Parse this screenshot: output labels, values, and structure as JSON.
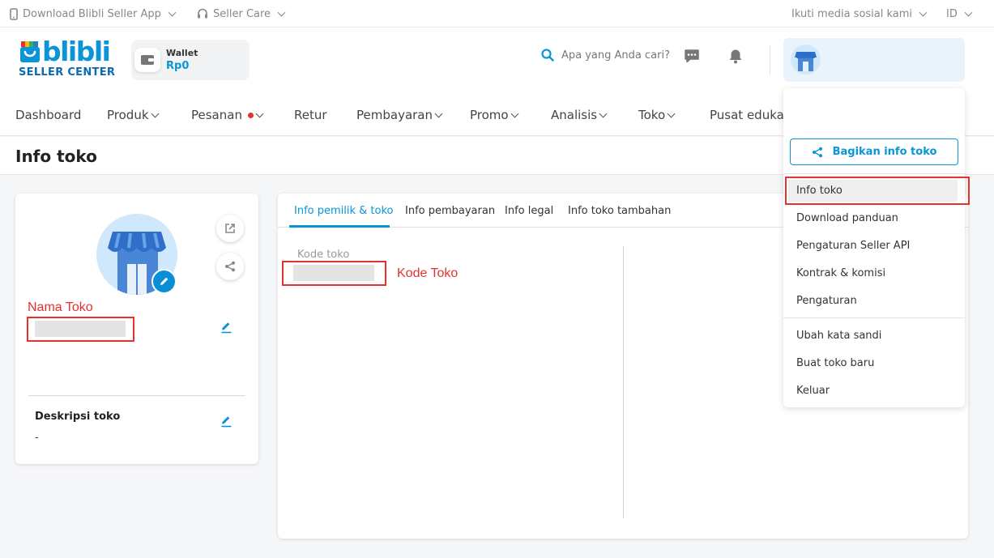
{
  "topbar": {
    "download_app": "Download Blibli Seller App",
    "seller_care": "Seller Care",
    "social": "Ikuti media sosial kami",
    "language": "ID"
  },
  "brand": {
    "name": "blibli",
    "subtitle": "SELLER CENTER"
  },
  "wallet": {
    "label": "Wallet",
    "value": "Rp0"
  },
  "search": {
    "placeholder": "Apa yang Anda cari?"
  },
  "nav": {
    "items": [
      {
        "label": "Dashboard"
      },
      {
        "label": "Produk"
      },
      {
        "label": "Pesanan"
      },
      {
        "label": "Retur"
      },
      {
        "label": "Pembayaran"
      },
      {
        "label": "Promo"
      },
      {
        "label": "Analisis"
      },
      {
        "label": "Toko"
      },
      {
        "label": "Pusat edukasi"
      }
    ]
  },
  "page": {
    "title": "Info toko"
  },
  "profile": {
    "store_name_annotation": "Nama Toko",
    "description_label": "Deskripsi toko",
    "description_value": "-"
  },
  "tabs": [
    {
      "label": "Info pemilik & toko"
    },
    {
      "label": "Info pembayaran"
    },
    {
      "label": "Info legal"
    },
    {
      "label": "Info toko tambahan"
    }
  ],
  "main": {
    "store_code_label": "Kode toko",
    "store_code_annotation": "Kode Toko"
  },
  "dropdown": {
    "share_button": "Bagikan info toko",
    "items": [
      {
        "label": "Info toko"
      },
      {
        "label": "Download panduan"
      },
      {
        "label": "Pengaturan Seller API"
      },
      {
        "label": "Kontrak & komisi"
      },
      {
        "label": "Pengaturan"
      }
    ],
    "account_items": [
      {
        "label": "Ubah kata sandi"
      },
      {
        "label": "Buat toko baru"
      },
      {
        "label": "Keluar"
      }
    ]
  },
  "colors": {
    "primary": "#0a95d8",
    "annotation": "#e5322d"
  },
  "icons": [
    "phone-icon",
    "headset-icon",
    "wallet-icon",
    "search-icon",
    "chat-icon",
    "bell-icon",
    "store-avatar-icon",
    "pencil-icon",
    "external-link-icon",
    "share-icon"
  ]
}
